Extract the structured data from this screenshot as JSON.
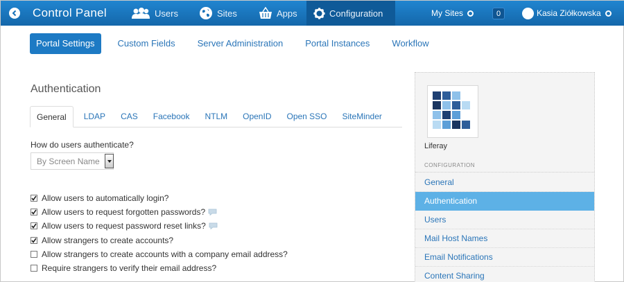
{
  "dock": {
    "title": "Control Panel",
    "items": [
      {
        "label": "Users",
        "icon": "users-icon"
      },
      {
        "label": "Sites",
        "icon": "globe-icon"
      },
      {
        "label": "Apps",
        "icon": "basket-icon"
      },
      {
        "label": "Configuration",
        "icon": "gear-icon"
      }
    ],
    "my_sites": "My Sites",
    "notification_count": "0",
    "user_name": "Kasia Ziółkowska"
  },
  "subnav": {
    "items": [
      "Portal Settings",
      "Custom Fields",
      "Server Administration",
      "Portal Instances",
      "Workflow"
    ]
  },
  "main": {
    "title": "Authentication",
    "tabs": [
      "General",
      "LDAP",
      "CAS",
      "Facebook",
      "NTLM",
      "OpenID",
      "Open SSO",
      "SiteMinder"
    ],
    "question": "How do users authenticate?",
    "select_value": "By Screen Name",
    "checkboxes": [
      {
        "label": "Allow users to automatically login?",
        "checked": true,
        "help": false
      },
      {
        "label": "Allow users to request forgotten passwords?",
        "checked": true,
        "help": true
      },
      {
        "label": "Allow users to request password reset links?",
        "checked": true,
        "help": true
      },
      {
        "label": "Allow strangers to create accounts?",
        "checked": true,
        "help": false
      },
      {
        "label": "Allow strangers to create accounts with a company email address?",
        "checked": false,
        "help": false
      },
      {
        "label": "Require strangers to verify their email address?",
        "checked": false,
        "help": false
      }
    ]
  },
  "panel": {
    "company": "Liferay",
    "heading": "CONFIGURATION",
    "items": [
      "General",
      "Authentication",
      "Users",
      "Mail Host Names",
      "Email Notifications",
      "Content Sharing"
    ]
  },
  "colors": {
    "dock": "#1872b8",
    "accent": "#1d7ac4",
    "link": "#2a75b8",
    "active_item": "#5db1e6"
  }
}
